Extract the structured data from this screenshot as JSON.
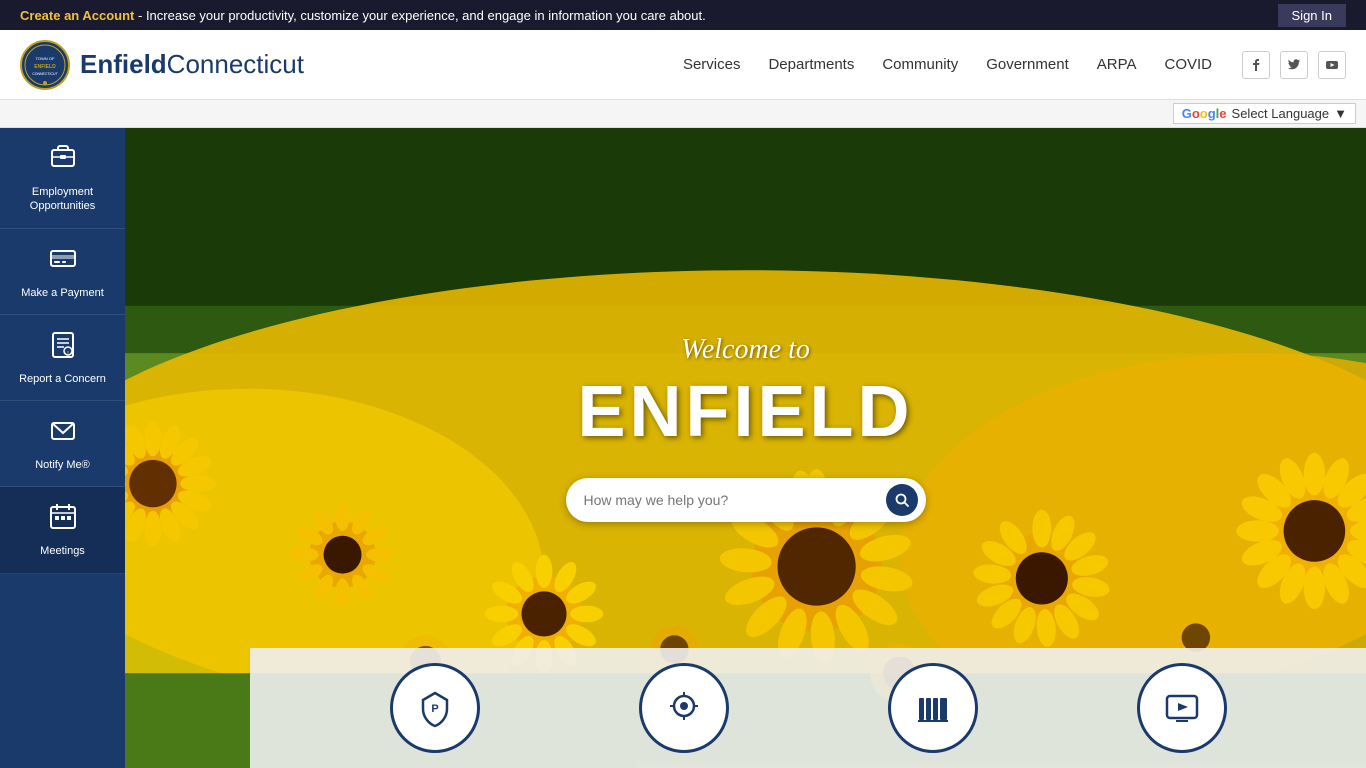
{
  "topbar": {
    "announcement_link": "Create an Account",
    "announcement_text": " - Increase your productivity, customize your experience, and engage in information you care about.",
    "signin_label": "Sign In"
  },
  "header": {
    "logo_text_enfield": "Enfield",
    "logo_text_connecticut": "Connecticut",
    "nav": [
      {
        "label": "Services",
        "id": "nav-services"
      },
      {
        "label": "Departments",
        "id": "nav-departments"
      },
      {
        "label": "Community",
        "id": "nav-community"
      },
      {
        "label": "Government",
        "id": "nav-government"
      },
      {
        "label": "ARPA",
        "id": "nav-arpa"
      },
      {
        "label": "COVID",
        "id": "nav-covid"
      }
    ],
    "social": [
      {
        "icon": "f",
        "name": "facebook"
      },
      {
        "icon": "𝕥",
        "name": "twitter"
      },
      {
        "icon": "▶",
        "name": "youtube"
      }
    ]
  },
  "translate": {
    "label": "Select Language",
    "dropdown_arrow": "▼"
  },
  "sidebar": {
    "items": [
      {
        "label": "Employment Opportunities",
        "icon": "employment"
      },
      {
        "label": "Make a Payment",
        "icon": "payment"
      },
      {
        "label": "Report a Concern",
        "icon": "report"
      },
      {
        "label": "Notify Me®",
        "icon": "notify"
      },
      {
        "label": "Meetings",
        "icon": "meetings",
        "active": true
      }
    ]
  },
  "hero": {
    "welcome_text": "Welcome to",
    "title": "ENFIELD",
    "search_placeholder": "How may we help you?"
  },
  "bottom_icons": [
    {
      "icon": "police",
      "name": "police-icon"
    },
    {
      "icon": "map",
      "name": "map-icon"
    },
    {
      "icon": "library",
      "name": "library-icon"
    },
    {
      "icon": "media",
      "name": "media-icon"
    }
  ]
}
